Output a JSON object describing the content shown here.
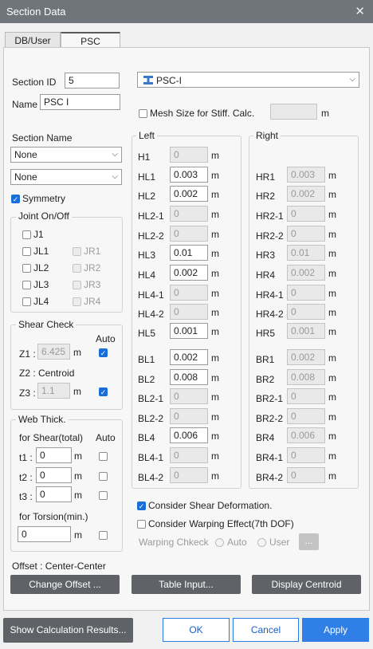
{
  "window": {
    "title": "Section Data",
    "close": "✕"
  },
  "tabs": [
    "DB/User",
    "PSC"
  ],
  "section": {
    "id_label": "Section ID",
    "id_value": "5",
    "name_label": "Name",
    "name_value": "PSC I",
    "type_value": "PSC-I",
    "mesh_label": "Mesh Size for Stiff. Calc.",
    "mesh_unit": "m",
    "section_name_label": "Section Name",
    "section_name_1": "None",
    "section_name_2": "None",
    "symmetry_label": "Symmetry"
  },
  "joint": {
    "title": "Joint On/Off",
    "items": [
      "J1",
      "JL1",
      "JR1",
      "JL2",
      "JR2",
      "JL3",
      "JR3",
      "JL4",
      "JR4"
    ]
  },
  "shear": {
    "title": "Shear Check",
    "auto": "Auto",
    "z1_label": "Z1 :",
    "z1_value": "6.425",
    "unit": "m",
    "z2_label": "Z2 :  Centroid",
    "z3_label": "Z3 :",
    "z3_value": "1.1"
  },
  "web": {
    "title": "Web Thick.",
    "shear_label": "for Shear(total)",
    "auto": "Auto",
    "t1": "t1 :",
    "t2": "t2 :",
    "t3": "t3 :",
    "t1_value": "0",
    "t2_value": "0",
    "t3_value": "0",
    "torsion_label": "for Torsion(min.)",
    "torsion_value": "0",
    "unit": "m"
  },
  "left": {
    "title": "Left",
    "unit": "m",
    "rows": [
      {
        "label": "H1",
        "value": "0"
      },
      {
        "label": "HL1",
        "value": "0.003"
      },
      {
        "label": "HL2",
        "value": "0.002"
      },
      {
        "label": "HL2-1",
        "value": "0"
      },
      {
        "label": "HL2-2",
        "value": "0"
      },
      {
        "label": "HL3",
        "value": "0.01"
      },
      {
        "label": "HL4",
        "value": "0.002"
      },
      {
        "label": "HL4-1",
        "value": "0"
      },
      {
        "label": "HL4-2",
        "value": "0"
      },
      {
        "label": "HL5",
        "value": "0.001"
      },
      {
        "label": "BL1",
        "value": "0.002"
      },
      {
        "label": "BL2",
        "value": "0.008"
      },
      {
        "label": "BL2-1",
        "value": "0"
      },
      {
        "label": "BL2-2",
        "value": "0"
      },
      {
        "label": "BL4",
        "value": "0.006"
      },
      {
        "label": "BL4-1",
        "value": "0"
      },
      {
        "label": "BL4-2",
        "value": "0"
      }
    ]
  },
  "right": {
    "title": "Right",
    "unit": "m",
    "rows": [
      {
        "label": "HR1",
        "value": "0.003"
      },
      {
        "label": "HR2",
        "value": "0.002"
      },
      {
        "label": "HR2-1",
        "value": "0"
      },
      {
        "label": "HR2-2",
        "value": "0"
      },
      {
        "label": "HR3",
        "value": "0.01"
      },
      {
        "label": "HR4",
        "value": "0.002"
      },
      {
        "label": "HR4-1",
        "value": "0"
      },
      {
        "label": "HR4-2",
        "value": "0"
      },
      {
        "label": "HR5",
        "value": "0.001"
      },
      {
        "label": "BR1",
        "value": "0.002"
      },
      {
        "label": "BR2",
        "value": "0.008"
      },
      {
        "label": "BR2-1",
        "value": "0"
      },
      {
        "label": "BR2-2",
        "value": "0"
      },
      {
        "label": "BR4",
        "value": "0.006"
      },
      {
        "label": "BR4-1",
        "value": "0"
      },
      {
        "label": "BR4-2",
        "value": "0"
      }
    ]
  },
  "options": {
    "shear_def": "Consider Shear Deformation.",
    "warping": "Consider Warping Effect(7th DOF)",
    "warping_check": "Warping Chkeck",
    "auto": "Auto",
    "user": "User",
    "more": "..."
  },
  "offset": {
    "label": "Offset :  Center-Center"
  },
  "buttons": {
    "change_offset": "Change Offset ...",
    "table_input": "Table Input...",
    "display_centroid": "Display Centroid",
    "show_results": "Show Calculation Results...",
    "ok": "OK",
    "cancel": "Cancel",
    "apply": "Apply"
  }
}
